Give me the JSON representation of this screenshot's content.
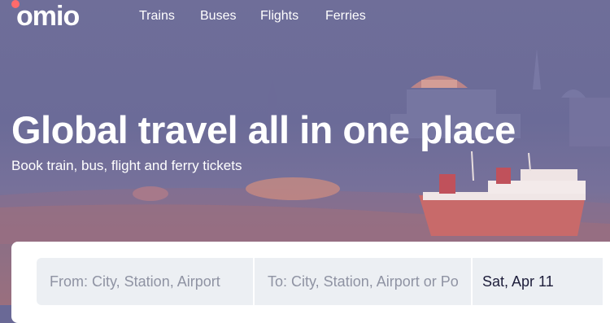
{
  "brand": {
    "logo_text": "omio"
  },
  "nav": {
    "items": [
      {
        "label": "Trains"
      },
      {
        "label": "Buses"
      },
      {
        "label": "Flights"
      },
      {
        "label": "Ferries"
      }
    ]
  },
  "hero": {
    "title": "Global travel all in one place",
    "subtitle": "Book train, bus, flight and ferry tickets"
  },
  "search": {
    "from_placeholder": "From: City, Station, Airport",
    "to_placeholder": "To: City, Station, Airport or Port",
    "date_value": "Sat, Apr 11"
  },
  "colors": {
    "brand_dot": "#ff6b6b",
    "hero_purple": "#6b6b98",
    "field_bg": "#eceff3"
  }
}
